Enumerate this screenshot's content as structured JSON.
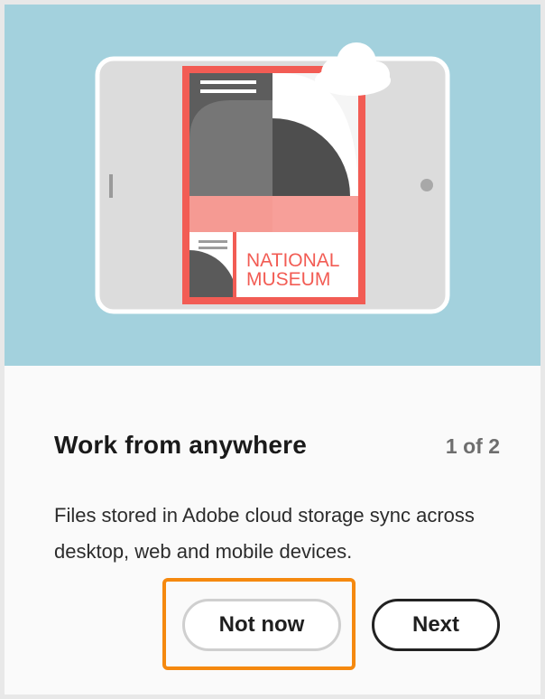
{
  "hero": {
    "background": "#a3d1dd",
    "illustration": {
      "poster_text_line1": "NATIONAL",
      "poster_text_line2": "MUSEUM",
      "accent_color": "#f25c54",
      "icon": "cloud-icon"
    }
  },
  "onboarding": {
    "title": "Work from anywhere",
    "step_indicator": "1 of 2",
    "description": "Files stored in Adobe cloud storage sync across desktop, web and mobile devices.",
    "highlight_color": "#f5890f"
  },
  "actions": {
    "not_now_label": "Not now",
    "next_label": "Next"
  }
}
